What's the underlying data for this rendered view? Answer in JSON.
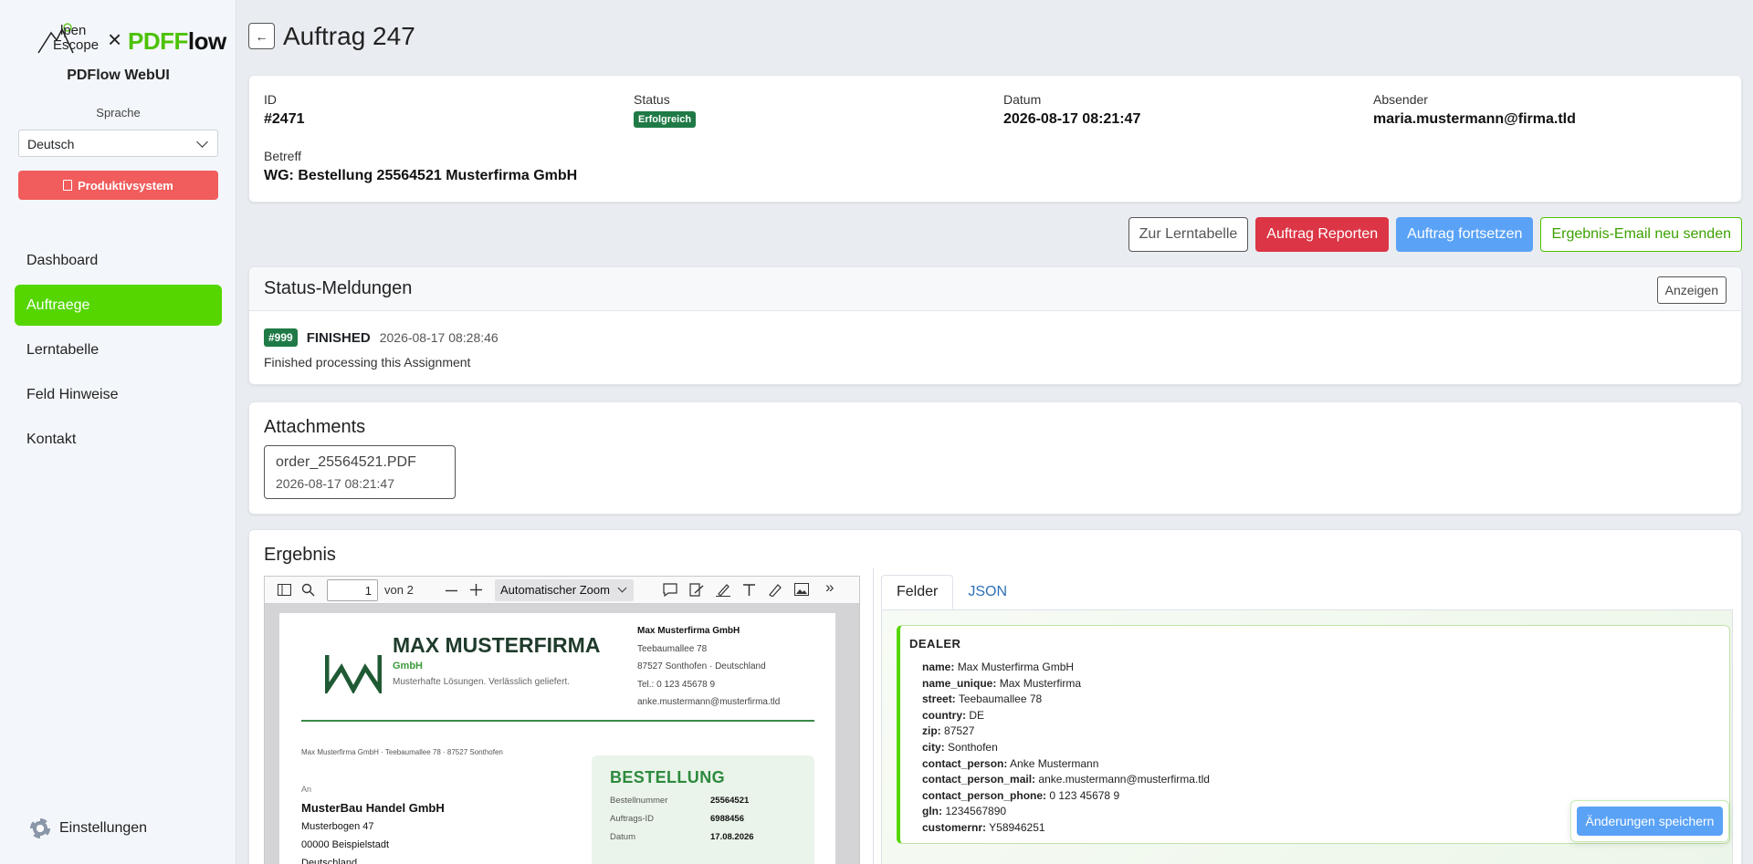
{
  "sidebar": {
    "logo_part1": "lpen",
    "logo_part2": "Escope",
    "logo_x": "×",
    "logo_pdf": "PDF",
    "logo_low": "low",
    "app_title": "PDFlow WebUI",
    "language_label": "Sprache",
    "language_value": "Deutsch",
    "prod_label": "Produktivsystem",
    "nav": [
      "Dashboard",
      "Auftraege",
      "Lerntabelle",
      "Feld Hinweise",
      "Kontakt"
    ],
    "settings_label": "Einstellungen"
  },
  "header": {
    "back": "←",
    "title": "Auftrag 247"
  },
  "info": {
    "id_label": "ID",
    "id_value": "#2471",
    "status_label": "Status",
    "status_value": "Erfolgreich",
    "date_label": "Datum",
    "date_value": "2026-08-17 08:21:47",
    "sender_label": "Absender",
    "sender_value": "maria.mustermann@firma.tld",
    "subject_label": "Betreff",
    "subject_value": "WG: Bestellung 25564521 Musterfirma GmbH"
  },
  "actions": {
    "learn": "Zur Lerntabelle",
    "report": "Auftrag Reporten",
    "continue": "Auftrag fortsetzen",
    "resend": "Ergebnis-Email neu senden"
  },
  "status_card": {
    "title": "Status-Meldungen",
    "show": "Anzeigen",
    "badge": "#999",
    "state": "FINISHED",
    "timestamp": "2026-08-17 08:28:46",
    "message": "Finished processing this Assignment"
  },
  "attachments": {
    "title": "Attachments",
    "file_name": "order_25564521.PDF",
    "file_date": "2026-08-17 08:21:47"
  },
  "result": {
    "title": "Ergebnis",
    "viewer": {
      "page": "1",
      "of": "von 2",
      "zoom": "Automatischer Zoom",
      "more": "»"
    },
    "doc": {
      "company": "MAX MUSTERFIRMA",
      "gmbh": "GmbH",
      "tagline": "Musterhafte Lösungen. Verlässlich geliefert.",
      "addr_name": "Max Musterfirma GmbH",
      "addr_street": "Teebaumallee 78",
      "addr_city": "87527 Sonthofen · Deutschland",
      "addr_tel": "Tel.: 0 123 45678 9",
      "addr_mail": "anke.mustermann@musterfirma.tld",
      "sender_line": "Max Musterfirma GmbH · Teebaumallee 78 · 87527 Sonthofen",
      "an": "An",
      "rcpt_name": "MusterBau Handel GmbH",
      "rcpt_street": "Musterbogen 47",
      "rcpt_city": "00000 Beispielstadt",
      "rcpt_country": "Deutschland",
      "box_title": "BESTELLUNG",
      "k1": "Bestellnummer",
      "v1": "25564521",
      "k2": "Auftrags-ID",
      "v2": "6988456",
      "k3": "Datum",
      "v3": "17.08.2026"
    },
    "tabs": [
      "Felder",
      "JSON"
    ],
    "dealer_title": "DEALER",
    "fields": [
      {
        "k": "name:",
        "v": "Max Musterfirma GmbH"
      },
      {
        "k": "name_unique:",
        "v": "Max Musterfirma"
      },
      {
        "k": "street:",
        "v": "Teebaumallee 78"
      },
      {
        "k": "country:",
        "v": "DE"
      },
      {
        "k": "zip:",
        "v": "87527"
      },
      {
        "k": "city:",
        "v": "Sonthofen"
      },
      {
        "k": "contact_person:",
        "v": "Anke Mustermann"
      },
      {
        "k": "contact_person_mail:",
        "v": "anke.mustermann@musterfirma.tld"
      },
      {
        "k": "contact_person_phone:",
        "v": "0 123 45678 9"
      },
      {
        "k": "gln:",
        "v": "1234567890"
      },
      {
        "k": "customernr:",
        "v": "Y58946251"
      }
    ],
    "save": "Änderungen speichern"
  }
}
